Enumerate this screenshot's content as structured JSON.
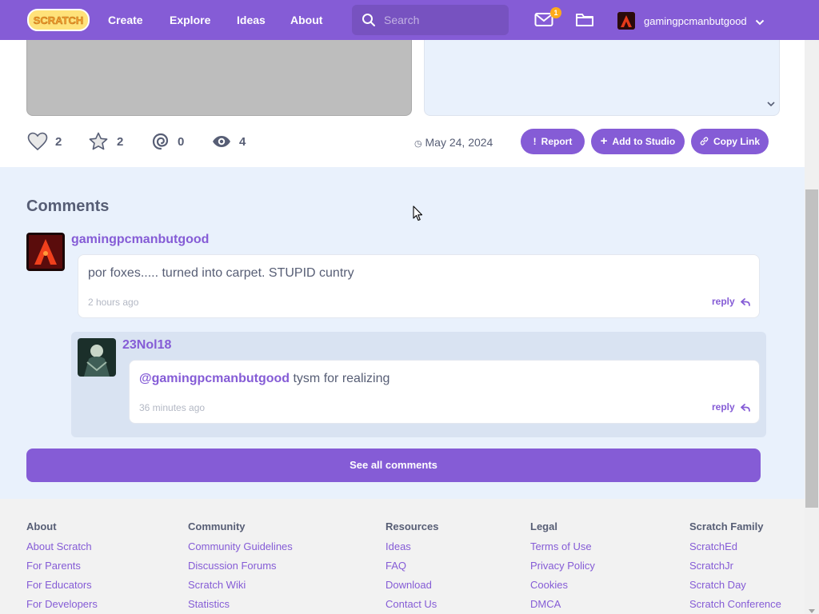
{
  "nav": {
    "logo_text": "SCRATCH",
    "links": [
      {
        "label": "Create"
      },
      {
        "label": "Explore"
      },
      {
        "label": "Ideas"
      },
      {
        "label": "About"
      }
    ],
    "search_placeholder": "Search",
    "message_count": "1",
    "username": "gamingpcmanbutgood"
  },
  "project": {
    "stats": {
      "loves": "2",
      "favorites": "2",
      "remixes": "0",
      "views": "4"
    },
    "date": "May 24, 2024",
    "buttons": {
      "report": "Report",
      "add_to_studio": "Add to Studio",
      "copy_link": "Copy Link"
    }
  },
  "comments": {
    "title": "Comments",
    "items": [
      {
        "author": "gamingpcmanbutgood",
        "text": "por foxes..... turned into carpet. STUPID cuntry",
        "time": "2 hours ago",
        "reply_label": "reply"
      }
    ],
    "replies": [
      {
        "author": "23Nol18",
        "mention": "@gamingpcmanbutgood",
        "text": " tysm for realizing",
        "time": "36 minutes ago",
        "reply_label": "reply"
      }
    ],
    "see_all": "See all comments"
  },
  "footer": {
    "columns": [
      {
        "heading": "About",
        "links": [
          "About Scratch",
          "For Parents",
          "For Educators",
          "For Developers"
        ]
      },
      {
        "heading": "Community",
        "links": [
          "Community Guidelines",
          "Discussion Forums",
          "Scratch Wiki",
          "Statistics"
        ]
      },
      {
        "heading": "Resources",
        "links": [
          "Ideas",
          "FAQ",
          "Download",
          "Contact Us"
        ]
      },
      {
        "heading": "Legal",
        "links": [
          "Terms of Use",
          "Privacy Policy",
          "Cookies",
          "DMCA"
        ]
      },
      {
        "heading": "Scratch Family",
        "links": [
          "ScratchEd",
          "ScratchJr",
          "Scratch Day",
          "Scratch Conference"
        ]
      }
    ]
  },
  "colors": {
    "brand_purple": "#855cd6",
    "background": "#e9f1fc",
    "text": "#575e75",
    "badge": "#ffab1a"
  },
  "icons": [
    "search-icon",
    "messages-icon",
    "folder-icon",
    "chevron-down-icon",
    "heart-icon",
    "star-icon",
    "remix-icon",
    "eye-icon",
    "report-icon",
    "plus-icon",
    "link-icon",
    "reply-icon"
  ]
}
